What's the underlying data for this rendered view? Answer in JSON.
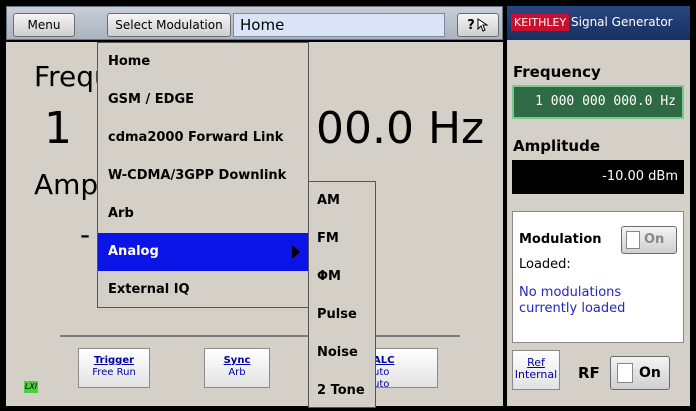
{
  "topbar": {
    "menu_label": "Menu",
    "select_modulation_label": "Select Modulation",
    "current_mode": "Home",
    "help_label": "?"
  },
  "main": {
    "freq_label": "Frequ",
    "freq_digit": "1",
    "freq_value": "00.0 Hz",
    "amp_label": "Ampl",
    "amp_dash": "-"
  },
  "dropdown": {
    "items": [
      {
        "label": "Home"
      },
      {
        "label": "GSM / EDGE"
      },
      {
        "label": "cdma2000 Forward Link"
      },
      {
        "label": "W-CDMA/3GPP Downlink"
      },
      {
        "label": "Arb"
      },
      {
        "label": "Analog",
        "selected": true
      },
      {
        "label": "External IQ"
      }
    ],
    "submenu": [
      {
        "label": "AM"
      },
      {
        "label": "FM"
      },
      {
        "label": "ΦM"
      },
      {
        "label": "Pulse"
      },
      {
        "label": "Noise"
      },
      {
        "label": "2 Tone"
      }
    ]
  },
  "softkeys": {
    "trigger_title": "Trigger",
    "trigger_value": "Free Run",
    "sync_title": "Sync",
    "sync_value": "Arb",
    "alc_title": "ALC",
    "alc_value1": "uto",
    "alc_value2": "uto",
    "lxi": "LXI"
  },
  "right_panel": {
    "brand": "KEITHLEY",
    "product": "Signal Generator",
    "frequency_title": "Frequency",
    "frequency_value": "1 000 000 000.0 Hz",
    "amplitude_title": "Amplitude",
    "amplitude_value": "-10.00 dBm",
    "modulation_title": "Modulation",
    "modulation_toggle": "On",
    "loaded_label": "Loaded:",
    "loaded_message": "No modulations currently loaded",
    "ref_title": "Ref",
    "ref_value": "Internal",
    "rf_label": "RF",
    "rf_toggle": "On"
  },
  "colors": {
    "menu_selected": "#0a14e6",
    "frequency_box": "#2e6b45",
    "brand_red": "#c8102e",
    "header_blue": "#173063",
    "message_blue": "#2424c4"
  }
}
